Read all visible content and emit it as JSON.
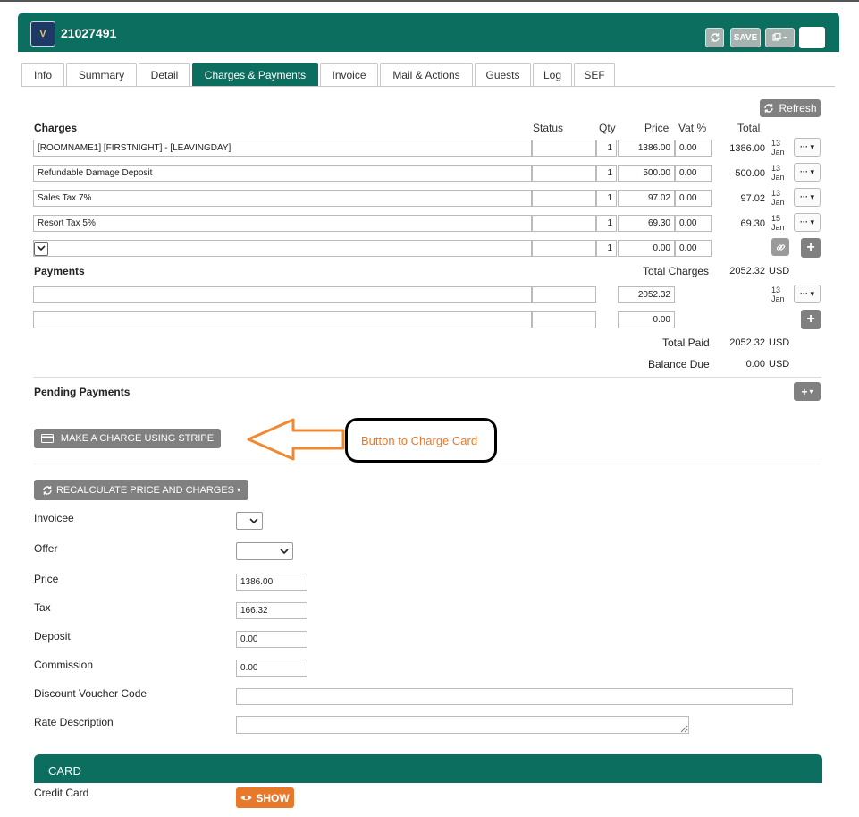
{
  "header": {
    "booking_id": "21027491",
    "logo_icon": "logo-icon",
    "save_label": "SAVE",
    "color": "#0b6e5e"
  },
  "tabs": [
    {
      "label": "Info"
    },
    {
      "label": "Summary"
    },
    {
      "label": "Detail"
    },
    {
      "label": "Charges & Payments",
      "active": true
    },
    {
      "label": "Invoice"
    },
    {
      "label": "Mail & Actions"
    },
    {
      "label": "Guests"
    },
    {
      "label": "Log"
    },
    {
      "label": "SEF"
    }
  ],
  "refresh_label": "Refresh",
  "charges": {
    "title": "Charges",
    "columns": {
      "status": "Status",
      "qty": "Qty",
      "price": "Price",
      "vat": "Vat %",
      "total": "Total"
    },
    "rows": [
      {
        "desc": "[ROOMNAME1] [FIRSTNIGHT] - [LEAVINGDAY]",
        "status": "",
        "qty": "1",
        "price": "1386.00",
        "vat": "0.00",
        "total": "1386.00",
        "date_day": "13",
        "date_month": "Jan"
      },
      {
        "desc": "Refundable Damage Deposit",
        "status": "",
        "qty": "1",
        "price": "500.00",
        "vat": "0.00",
        "total": "500.00",
        "date_day": "13",
        "date_month": "Jan"
      },
      {
        "desc": "Sales Tax 7%",
        "status": "",
        "qty": "1",
        "price": "97.02",
        "vat": "0.00",
        "total": "97.02",
        "date_day": "13",
        "date_month": "Jan"
      },
      {
        "desc": "Resort Tax 5%",
        "status": "",
        "qty": "1",
        "price": "69.30",
        "vat": "0.00",
        "total": "69.30",
        "date_day": "15",
        "date_month": "Jan"
      }
    ],
    "new_row": {
      "qty": "1",
      "price": "0.00",
      "vat": "0.00"
    }
  },
  "payments": {
    "title": "Payments",
    "total_charges_label": "Total Charges",
    "total_charges_value": "2052.32",
    "currency": "USD",
    "rows": [
      {
        "desc": "",
        "status": "",
        "amount": "2052.32",
        "date_day": "13",
        "date_month": "Jan"
      }
    ],
    "new_row": {
      "amount": "0.00"
    },
    "total_paid_label": "Total Paid",
    "total_paid_value": "2052.32",
    "balance_due_label": "Balance Due",
    "balance_due_value": "0.00"
  },
  "pending": {
    "title": "Pending Payments"
  },
  "stripe_button_label": "MAKE A CHARGE USING STRIPE",
  "annotation_text": "Button to Charge Card",
  "recalc_button_label": "RECALCULATE PRICE AND CHARGES",
  "form": {
    "invoicee_label": "Invoicee",
    "offer_label": "Offer",
    "price_label": "Price",
    "price_value": "1386.00",
    "tax_label": "Tax",
    "tax_value": "166.32",
    "deposit_label": "Deposit",
    "deposit_value": "0.00",
    "commission_label": "Commission",
    "commission_value": "0.00",
    "voucher_label": "Discount Voucher Code",
    "voucher_value": "",
    "rate_desc_label": "Rate Description",
    "rate_desc_value": ""
  },
  "card": {
    "title": "CARD",
    "credit_card_label": "Credit Card",
    "show_label": "SHOW"
  }
}
